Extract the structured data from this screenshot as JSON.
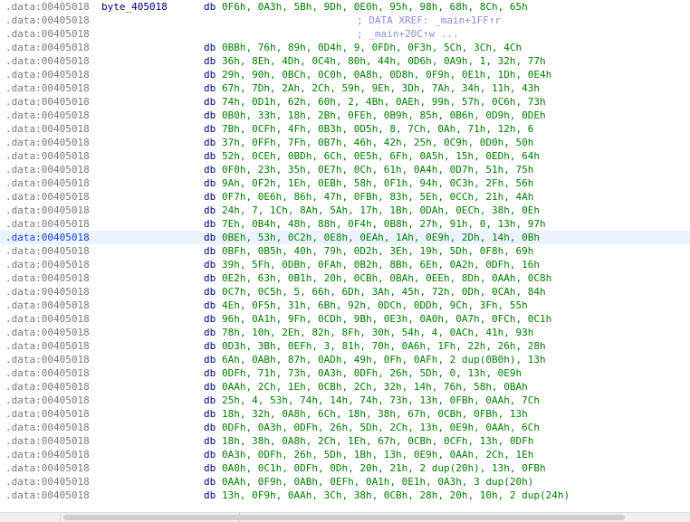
{
  "listing": {
    "highlight_index": 17,
    "lines": [
      {
        "addr": ".data:00405018",
        "label": "byte_405018",
        "op": "db",
        "args": "0F6h, 0A3h, 5Bh, 9Dh, 0E0h, 95h, 98h, 68h, 8Ch, 65h",
        "comment": ""
      },
      {
        "addr": ".data:00405018",
        "label": "",
        "op": "",
        "args": "",
        "comment": "; DATA XREF: _main+1FF↑r"
      },
      {
        "addr": ".data:00405018",
        "label": "",
        "op": "",
        "args": "",
        "comment": "; _main+20C↑w ..."
      },
      {
        "addr": ".data:00405018",
        "label": "",
        "op": "db",
        "args": "0BBh, 76h, 89h, 0D4h, 9, 0FDh, 0F3h, 5Ch, 3Ch, 4Ch",
        "comment": ""
      },
      {
        "addr": ".data:00405018",
        "label": "",
        "op": "db",
        "args": "36h, 8Eh, 4Dh, 0C4h, 80h, 44h, 0D6h, 0A9h, 1, 32h, 77h",
        "comment": ""
      },
      {
        "addr": ".data:00405018",
        "label": "",
        "op": "db",
        "args": "29h, 90h, 0BCh, 0C0h, 0A8h, 0D8h, 0F9h, 0E1h, 1Dh, 0E4h",
        "comment": ""
      },
      {
        "addr": ".data:00405018",
        "label": "",
        "op": "db",
        "args": "67h, 7Dh, 2Ah, 2Ch, 59h, 9Eh, 3Dh, 7Ah, 34h, 11h, 43h",
        "comment": ""
      },
      {
        "addr": ".data:00405018",
        "label": "",
        "op": "db",
        "args": "74h, 0D1h, 62h, 60h, 2, 4Bh, 0AEh, 99h, 57h, 0C6h, 73h",
        "comment": ""
      },
      {
        "addr": ".data:00405018",
        "label": "",
        "op": "db",
        "args": "0B0h, 33h, 18h, 2Bh, 0FEh, 0B9h, 85h, 0B6h, 0D9h, 0DEh",
        "comment": ""
      },
      {
        "addr": ".data:00405018",
        "label": "",
        "op": "db",
        "args": "7Bh, 0CFh, 4Fh, 0B3h, 0D5h, 8, 7Ch, 0Ah, 71h, 12h, 6",
        "comment": ""
      },
      {
        "addr": ".data:00405018",
        "label": "",
        "op": "db",
        "args": "37h, 0FFh, 7Fh, 0B7h, 46h, 42h, 25h, 0C9h, 0D0h, 50h",
        "comment": ""
      },
      {
        "addr": ".data:00405018",
        "label": "",
        "op": "db",
        "args": "52h, 0CEh, 0BDh, 6Ch, 0E5h, 6Fh, 0A5h, 15h, 0EDh, 64h",
        "comment": ""
      },
      {
        "addr": ".data:00405018",
        "label": "",
        "op": "db",
        "args": "0F0h, 23h, 35h, 0E7h, 0Ch, 61h, 0A4h, 0D7h, 51h, 75h",
        "comment": ""
      },
      {
        "addr": ".data:00405018",
        "label": "",
        "op": "db",
        "args": "9Ah, 0F2h, 1Eh, 0EBh, 58h, 0F1h, 94h, 0C3h, 2Fh, 56h",
        "comment": ""
      },
      {
        "addr": ".data:00405018",
        "label": "",
        "op": "db",
        "args": "0F7h, 0E6h, 86h, 47h, 0FBh, 83h, 5Eh, 0CCh, 21h, 4Ah",
        "comment": ""
      },
      {
        "addr": ".data:00405018",
        "label": "",
        "op": "db",
        "args": "24h, 7, 1Ch, 8Ah, 5Ah, 17h, 1Bh, 0DAh, 0ECh, 38h, 0Eh",
        "comment": ""
      },
      {
        "addr": ".data:00405018",
        "label": "",
        "op": "db",
        "args": "7Eh, 0B4h, 48h, 88h, 0F4h, 0B8h, 27h, 91h, 0, 13h, 97h",
        "comment": ""
      },
      {
        "addr": ".data:00405018",
        "label": "",
        "op": "db",
        "args": "0BEh, 53h, 0C2h, 0E8h, 0EAh, 1Ah, 0E9h, 2Dh, 14h, 0Bh",
        "comment": ""
      },
      {
        "addr": ".data:00405018",
        "label": "",
        "op": "db",
        "args": "0BFh, 0B5h, 40h, 79h, 0D2h, 3Eh, 19h, 5Dh, 0F8h, 69h",
        "comment": ""
      },
      {
        "addr": ".data:00405018",
        "label": "",
        "op": "db",
        "args": "39h, 5Fh, 0DBh, 0FAh, 0B2h, 8Bh, 6Eh, 0A2h, 0DFh, 16h",
        "comment": ""
      },
      {
        "addr": ".data:00405018",
        "label": "",
        "op": "db",
        "args": "0E2h, 63h, 0B1h, 20h, 0CBh, 0BAh, 0EEh, 8Dh, 0AAh, 0C8h",
        "comment": ""
      },
      {
        "addr": ".data:00405018",
        "label": "",
        "op": "db",
        "args": "0C7h, 0C5h, 5, 66h, 6Dh, 3Ah, 45h, 72h, 0Dh, 0CAh, 84h",
        "comment": ""
      },
      {
        "addr": ".data:00405018",
        "label": "",
        "op": "db",
        "args": "4Eh, 0F5h, 31h, 6Bh, 92h, 0DCh, 0DDh, 9Ch, 3Fh, 55h",
        "comment": ""
      },
      {
        "addr": ".data:00405018",
        "label": "",
        "op": "db",
        "args": "96h, 0A1h, 9Fh, 0CDh, 9Bh, 0E3h, 0A0h, 0A7h, 0FCh, 0C1h",
        "comment": ""
      },
      {
        "addr": ".data:00405018",
        "label": "",
        "op": "db",
        "args": "78h, 10h, 2Eh, 82h, 8Fh, 30h, 54h, 4, 0ACh, 41h, 93h",
        "comment": ""
      },
      {
        "addr": ".data:00405018",
        "label": "",
        "op": "db",
        "args": "0D3h, 3Bh, 0EFh, 3, 81h, 70h, 0A6h, 1Fh, 22h, 26h, 28h",
        "comment": ""
      },
      {
        "addr": ".data:00405018",
        "label": "",
        "op": "db",
        "args": "6Ah, 0ABh, 87h, 0ADh, 49h, 0Fh, 0AFh, 2 dup(0B0h), 13h",
        "comment": ""
      },
      {
        "addr": ".data:00405018",
        "label": "",
        "op": "db",
        "args": "0DFh, 71h, 73h, 0A3h, 0DFh, 26h, 5Dh, 0, 13h, 0E9h",
        "comment": ""
      },
      {
        "addr": ".data:00405018",
        "label": "",
        "op": "db",
        "args": "0AAh, 2Ch, 1Eh, 0CBh, 2Ch, 32h, 14h, 76h, 58h, 0BAh",
        "comment": ""
      },
      {
        "addr": ".data:00405018",
        "label": "",
        "op": "db",
        "args": "25h, 4, 53h, 74h, 14h, 74h, 73h, 13h, 0FBh, 0AAh, 7Ch",
        "comment": ""
      },
      {
        "addr": ".data:00405018",
        "label": "",
        "op": "db",
        "args": "18h, 32h, 0A8h, 6Ch, 18h, 38h, 67h, 0CBh, 0FBh, 13h",
        "comment": ""
      },
      {
        "addr": ".data:00405018",
        "label": "",
        "op": "db",
        "args": "0DFh, 0A3h, 0DFh, 26h, 5Dh, 2Ch, 13h, 0E9h, 0AAh, 6Ch",
        "comment": ""
      },
      {
        "addr": ".data:00405018",
        "label": "",
        "op": "db",
        "args": "18h, 38h, 0A8h, 2Ch, 1Eh, 67h, 0CBh, 0CFh, 13h, 0DFh",
        "comment": ""
      },
      {
        "addr": ".data:00405018",
        "label": "",
        "op": "db",
        "args": "0A3h, 0DFh, 26h, 5Dh, 1Bh, 13h, 0E9h, 0AAh, 2Ch, 1Eh",
        "comment": ""
      },
      {
        "addr": ".data:00405018",
        "label": "",
        "op": "db",
        "args": "0A0h, 0C1h, 0DFh, 0Dh, 20h, 21h, 2 dup(20h), 13h, 0FBh",
        "comment": ""
      },
      {
        "addr": ".data:00405018",
        "label": "",
        "op": "db",
        "args": "0AAh, 0F9h, 0ABh, 0EFh, 0A1h, 0E1h, 0A3h, 3 dup(20h)",
        "comment": ""
      },
      {
        "addr": ".data:00405018",
        "label": "",
        "op": "db",
        "args": "13h, 0F9h, 0AAh, 3Ch, 38h, 0CBh, 28h, 20h, 10h, 2 dup(24h)",
        "comment": ""
      }
    ]
  }
}
